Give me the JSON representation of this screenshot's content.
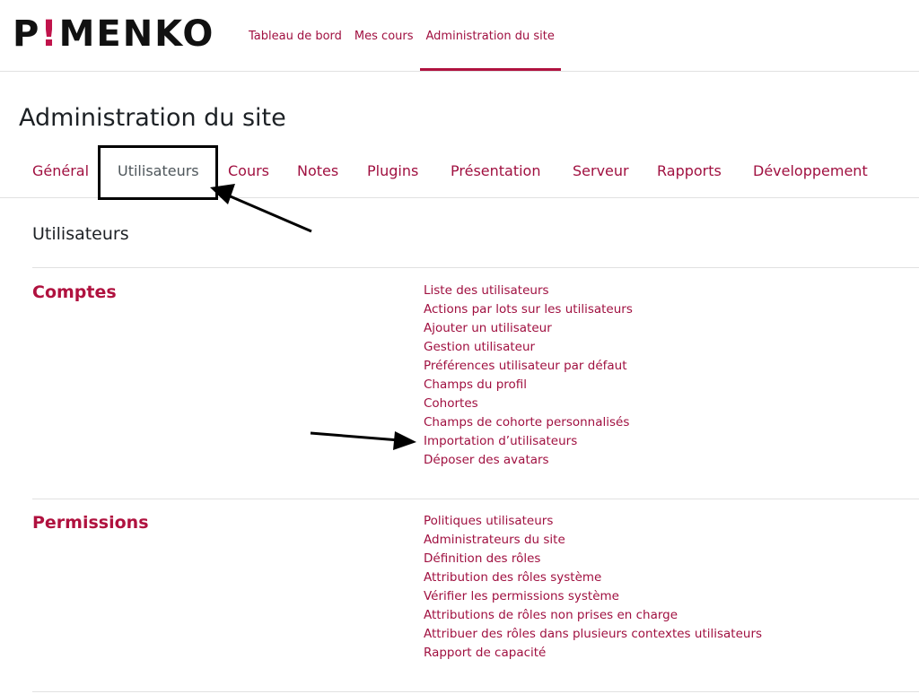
{
  "brand": {
    "logo_prefix": "P",
    "logo_bang": "!",
    "logo_suffix": "MENKO",
    "accent_color": "#b0123f"
  },
  "primary_nav": [
    {
      "label": "Tableau de bord"
    },
    {
      "label": "Mes cours"
    },
    {
      "label": "Administration du site",
      "active": true
    }
  ],
  "page_title": "Administration du site",
  "tabs": [
    {
      "label": "Général"
    },
    {
      "label": "Utilisateurs",
      "active": true
    },
    {
      "label": "Cours"
    },
    {
      "label": "Notes"
    },
    {
      "label": "Plugins"
    },
    {
      "label": "Présentation"
    },
    {
      "label": "Serveur"
    },
    {
      "label": "Rapports"
    },
    {
      "label": "Développement"
    }
  ],
  "section_heading": "Utilisateurs",
  "categories": [
    {
      "title": "Comptes",
      "links": [
        "Liste des utilisateurs",
        "Actions par lots sur les utilisateurs",
        "Ajouter un utilisateur",
        "Gestion utilisateur",
        "Préférences utilisateur par défaut",
        "Champs du profil",
        "Cohortes",
        "Champs de cohorte personnalisés",
        "Importation d’utilisateurs",
        "Déposer des avatars"
      ]
    },
    {
      "title": "Permissions",
      "links": [
        "Politiques utilisateurs",
        "Administrateurs du site",
        "Définition des rôles",
        "Attribution des rôles système",
        "Vérifier les permissions système",
        "Attributions de rôles non prises en charge",
        "Attribuer des rôles dans plusieurs contextes utilisateurs",
        "Rapport de capacité"
      ]
    }
  ]
}
